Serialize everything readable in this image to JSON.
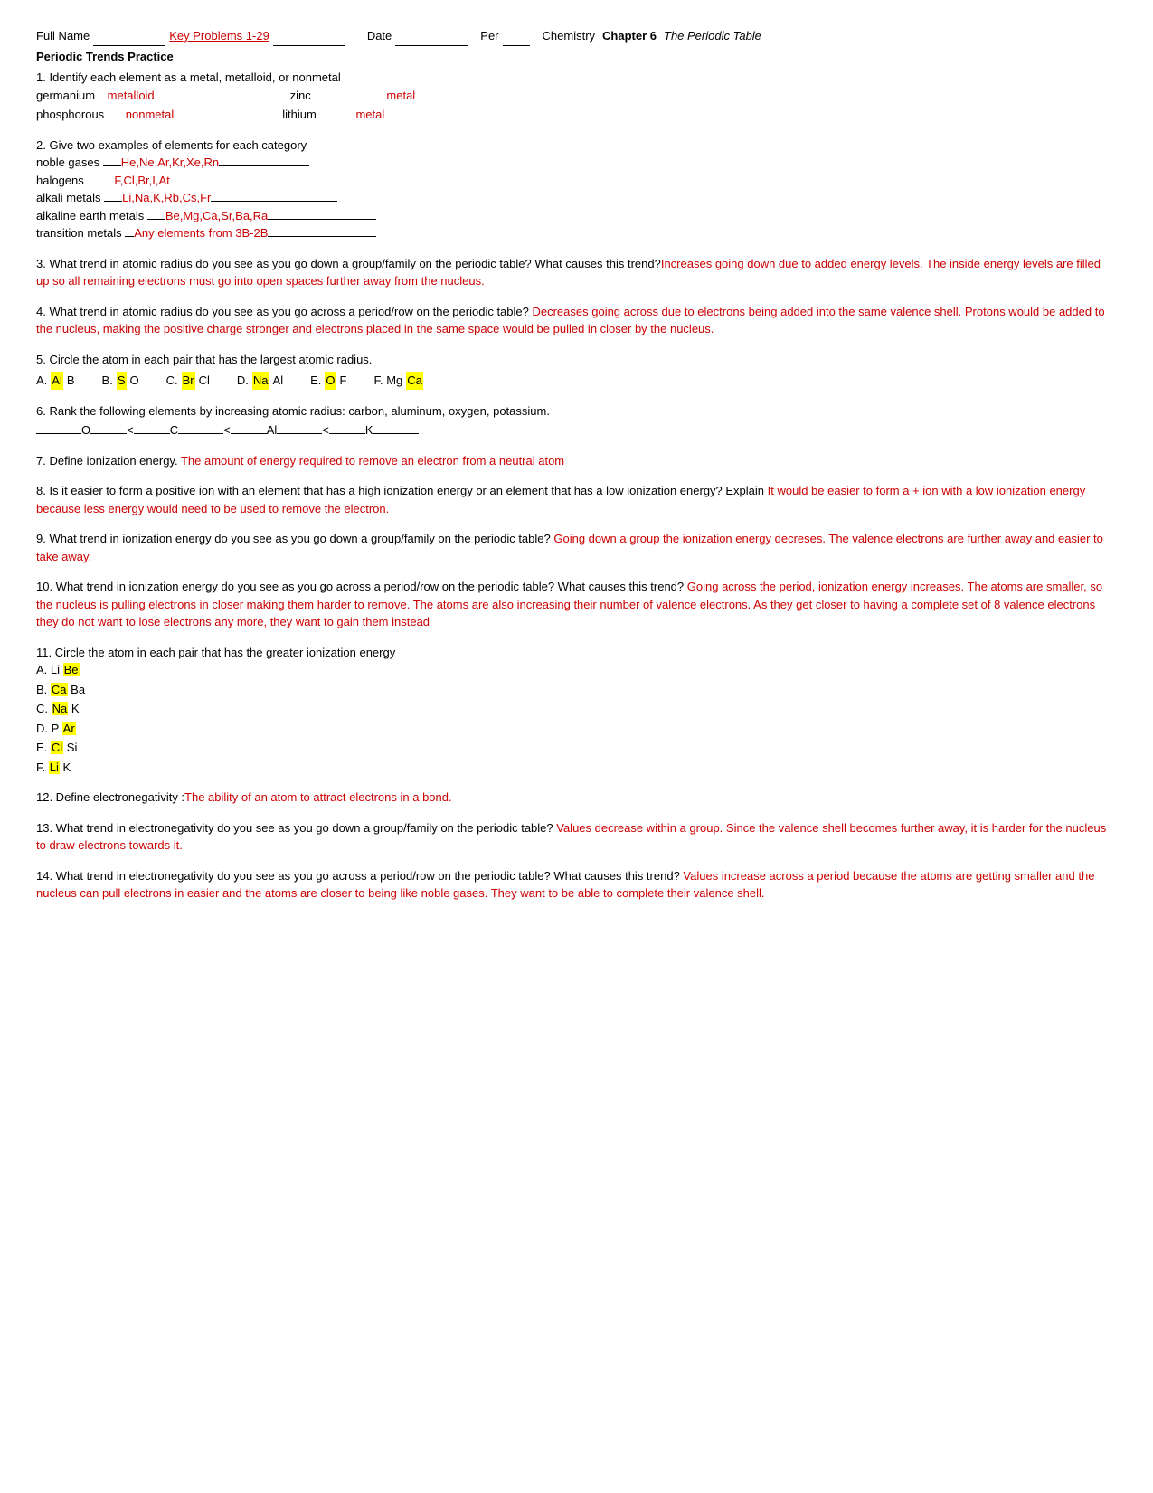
{
  "header": {
    "full_name_label": "Full Name",
    "name_value": "Key Problems 1-29",
    "date_label": "Date",
    "date_blank": "",
    "per_label": "Per",
    "per_blank": "",
    "course_label": "Chemistry",
    "chapter_bold": "Chapter 6",
    "chapter_italic": "The Periodic Table"
  },
  "section_title": "Periodic Trends Practice",
  "questions": [
    {
      "id": "q1",
      "text": "1. Identify each element as a metal, metalloid, or nonmetal",
      "items": [
        {
          "element": "germanium",
          "answer": "metalloid",
          "blank_before": true
        },
        {
          "element": "zinc",
          "answer": "metal",
          "position": "right"
        },
        {
          "element": "phosphorous",
          "answer": "nonmetal",
          "blank_before": true
        },
        {
          "element": "lithium",
          "answer": "metal",
          "position": "right"
        }
      ]
    },
    {
      "id": "q2",
      "text": "2. Give two examples of elements for each category",
      "items": [
        {
          "category": "noble gases",
          "answer": "He,Ne,Ar,Kr,Xe,Rn"
        },
        {
          "category": "halogens",
          "answer": "F,Cl,Br,I,At"
        },
        {
          "category": "alkali metals",
          "answer": "Li,Na,K,Rb,Cs,Fr"
        },
        {
          "category": "alkaline earth metals",
          "answer": "Be,Mg,Ca,Sr,Ba,Ra"
        },
        {
          "category": "transition metals",
          "answer": "Any elements from 3B-2B"
        }
      ]
    },
    {
      "id": "q3",
      "text": "3. What trend in atomic radius do you see as you go down a group/family on the periodic table? What causes this trend?",
      "answer": "Increases going down due to added energy levels.  The inside energy levels are filled up so all remaining electrons must go into open spaces further away from the nucleus."
    },
    {
      "id": "q4",
      "text": "4. What trend in atomic radius do you see as you go across a period/row on the periodic table?",
      "answer": "Decreases going across due to electrons being added into the same valence shell.  Protons would be added to the nucleus, making the positive charge stronger and electrons placed in the same space would be pulled in closer by the nucleus."
    },
    {
      "id": "q5",
      "text": "5. Circle the atom in each pair that has the largest atomic radius.",
      "options": [
        {
          "label": "A.",
          "left": "Al",
          "right": "B",
          "circled": "Al",
          "highlight": "Al"
        },
        {
          "label": "B.",
          "left": "S",
          "right": "O",
          "circled": "S",
          "highlight": "S"
        },
        {
          "label": "C.",
          "left": "Br",
          "right": "Cl",
          "circled": "Br",
          "highlight": "Br"
        },
        {
          "label": "D.",
          "left": "Na",
          "right": "Al",
          "circled": "Na",
          "highlight": "Na"
        },
        {
          "label": "E.",
          "left": "O",
          "right": "F",
          "circled": "O",
          "highlight": "O"
        },
        {
          "label": "F.",
          "left": "Mg",
          "right": "Ca",
          "circled": "Ca",
          "highlight": "Ca"
        }
      ]
    },
    {
      "id": "q6",
      "text": "6. Rank the following elements by increasing atomic radius: carbon, aluminum, oxygen, potassium.",
      "answer_line": "___O___<___C___<___Al___<___K___"
    },
    {
      "id": "q7",
      "text": "7. Define ionization energy.",
      "answer": "The amount of energy required to remove an electron from a neutral atom"
    },
    {
      "id": "q8",
      "text": "8. Is it easier to form a positive ion with an element that has a high ionization energy or an element that has a low ionization energy? Explain",
      "answer": "It would be easier to form a + ion with a low ionization energy because less energy would need to be used to remove the electron."
    },
    {
      "id": "q9",
      "text": "9. What trend in ionization energy do you see as you go down a group/family on the periodic table?",
      "answer": "Going down a group the ionization energy decreses.  The valence electrons are further away and easier to take away."
    },
    {
      "id": "q10",
      "text": "10. What trend in ionization energy do you see as you go across a period/row on the periodic table? What causes this trend?",
      "answer": "Going across the period, ionization energy increases.  The atoms are smaller, so the nucleus is pulling electrons in closer making them harder to remove.  The atoms are also increasing their number of valence electrons.  As they get closer to having a complete set of 8 valence electrons they do not want to lose electrons any more, they want to gain them instead"
    },
    {
      "id": "q11",
      "text": "11. Circle the atom in each pair that has the greater ionization energy",
      "options": [
        {
          "label": "A. Li",
          "circled": "Be",
          "other": "Be",
          "highlight": "Be"
        },
        {
          "label": "B.",
          "circled": "Ca",
          "other": "Ba",
          "highlight": "Ca"
        },
        {
          "label": "C.",
          "circled": "Na",
          "other": "K",
          "highlight": "Na"
        },
        {
          "label": "D. P",
          "circled": "Ar",
          "other": "Ar",
          "highlight": "Ar"
        },
        {
          "label": "E.",
          "circled": "Cl",
          "other": "Si",
          "highlight": "Cl"
        },
        {
          "label": "F.",
          "circled": "Li",
          "other": "K",
          "highlight": "Li"
        }
      ]
    },
    {
      "id": "q12",
      "text": "12. Define electronegativity :",
      "answer": "The ability of an atom to attract electrons in a bond."
    },
    {
      "id": "q13",
      "text": "13. What trend in electronegativity do you see as you go down a group/family on the periodic table?",
      "answer": "Values decrease within a group.  Since the valence shell becomes further away, it is harder for the nucleus to draw electrons towards it."
    },
    {
      "id": "q14",
      "text": "14. What trend in electronegativity do you see as you go across a period/row on the periodic table? What causes this trend?",
      "answer": "Values increase across a period because the atoms are getting smaller and the nucleus can pull electrons in easier and the atoms are closer to being like noble gases.  They want to be able to complete their valence shell."
    }
  ]
}
